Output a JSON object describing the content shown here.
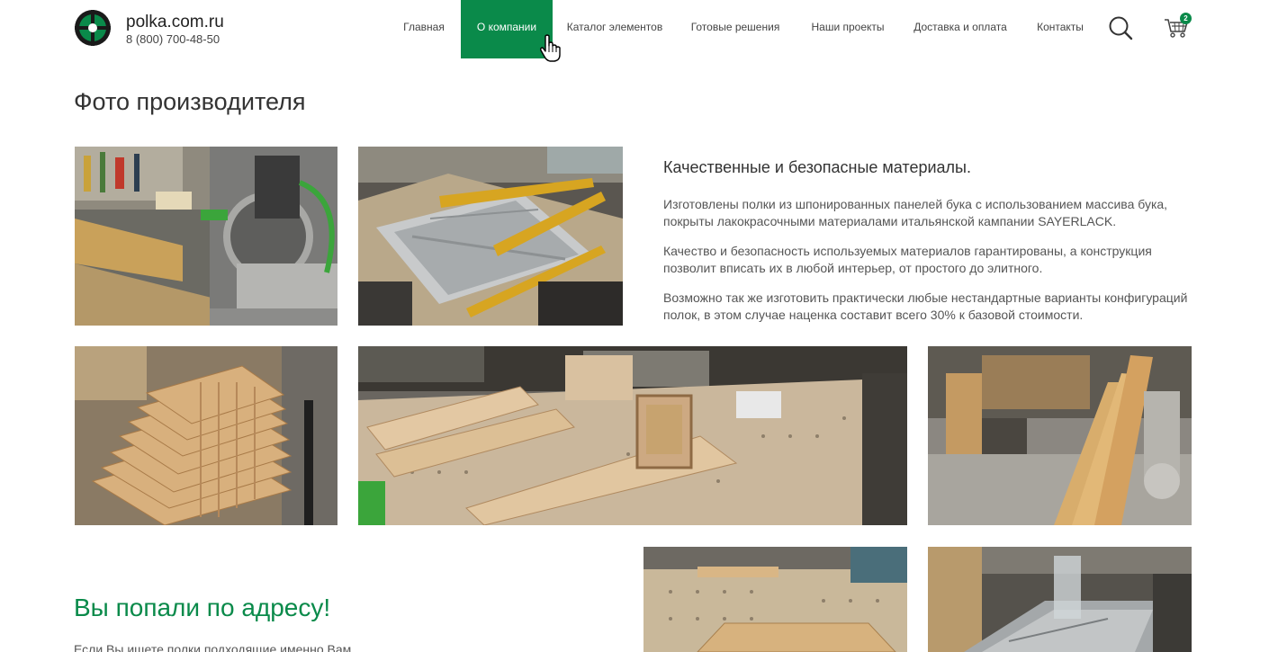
{
  "header": {
    "brand_name": "polka.com.ru",
    "phone": "8 (800) 700-48-50",
    "cart_count": "2"
  },
  "nav": {
    "items": [
      {
        "label": "Главная"
      },
      {
        "label": "О компании"
      },
      {
        "label": "Каталог элементов"
      },
      {
        "label": "Готовые решения"
      },
      {
        "label": "Наши проекты"
      },
      {
        "label": "Доставка и оплата"
      },
      {
        "label": "Контакты"
      }
    ],
    "active_index": 1
  },
  "main": {
    "page_title": "Фото производителя",
    "info_heading": "Качественные и безопасные материалы.",
    "paragraphs": [
      "Изготовлены полки из шпонированных панелей бука с использованием массива бука, покрыты лакокрасочными материалами итальянской кампании SAYERLACK.",
      "Качество и безопасность используемых материалов гарантированы, а конструкция позволит вписать их в любой интерьер, от простого до элитного.",
      "Возможно так же изготовить практически любые нестандартные варианты конфигураций полок, в этом случае наценка составит всего 30% к базовой стоимости."
    ],
    "headline": "Вы попали по адресу!",
    "intro_text": "Если Вы ищете полки подходящие именно Вам"
  },
  "colors": {
    "accent": "#0a8a4a"
  },
  "icons": [
    "logo-icon",
    "search-icon",
    "cart-icon",
    "hand-cursor-icon"
  ]
}
